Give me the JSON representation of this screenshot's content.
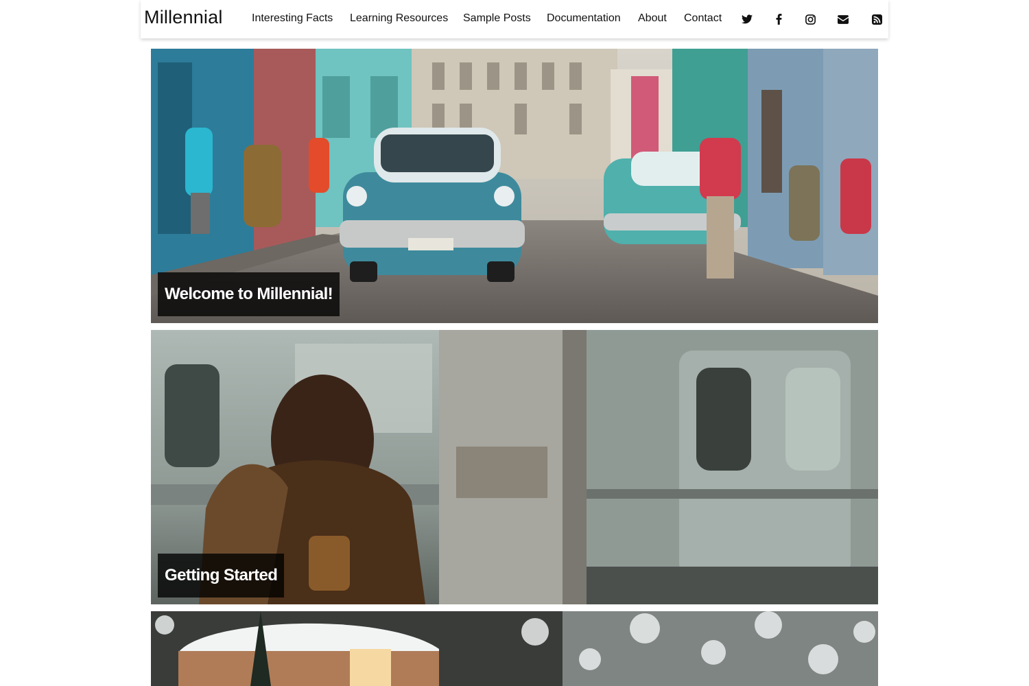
{
  "site": {
    "brand": "Millennial"
  },
  "nav": {
    "items": [
      {
        "label": "Interesting Facts"
      },
      {
        "label": "Learning Resources"
      },
      {
        "label": "Sample Posts"
      },
      {
        "label": "Documentation"
      },
      {
        "label": "About"
      },
      {
        "label": "Contact"
      }
    ],
    "social": [
      {
        "icon": "twitter-icon"
      },
      {
        "icon": "facebook-icon"
      },
      {
        "icon": "instagram-icon"
      },
      {
        "icon": "envelope-icon"
      },
      {
        "icon": "rss-icon"
      }
    ]
  },
  "posts": [
    {
      "title": "Welcome to Millennial!",
      "image": "street-with-vintage-cars"
    },
    {
      "title": "Getting Started",
      "image": "woman-at-subway-platform"
    },
    {
      "title": "",
      "image": "snowy-yurt-in-forest"
    }
  ]
}
